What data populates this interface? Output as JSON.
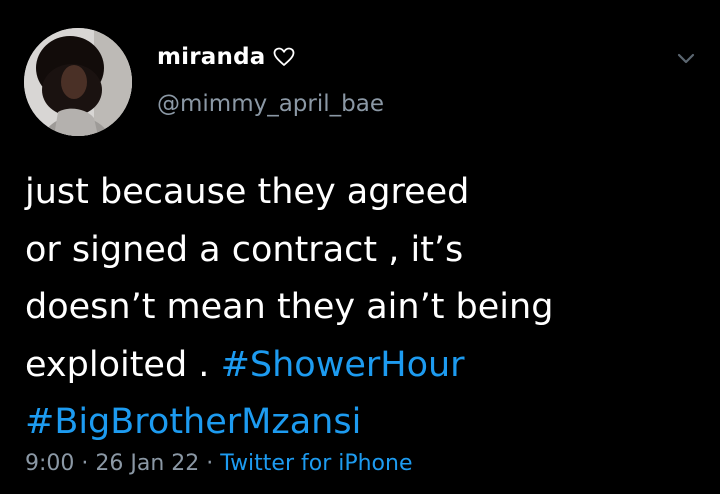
{
  "user": {
    "display_name": "miranda",
    "handle": "@mimmy_april_bae"
  },
  "tweet": {
    "text_line1": "just because they agreed",
    "text_line2": "or signed a contract , it’s",
    "text_line3": "doesn’t mean they ain’t being",
    "text_line4": "exploited . ",
    "hashtag1": "#ShowerHour",
    "hashtag2": "#BigBrotherMzansi"
  },
  "meta": {
    "time": "9:00",
    "separator": " · ",
    "date": "26 Jan 22",
    "source": "Twitter for iPhone"
  },
  "colors": {
    "background": "#000000",
    "link": "#1d9bf0",
    "secondary_text": "#8b98a5"
  },
  "icons": {
    "heart": "heart-outline-icon",
    "chevron": "chevron-down-icon"
  }
}
